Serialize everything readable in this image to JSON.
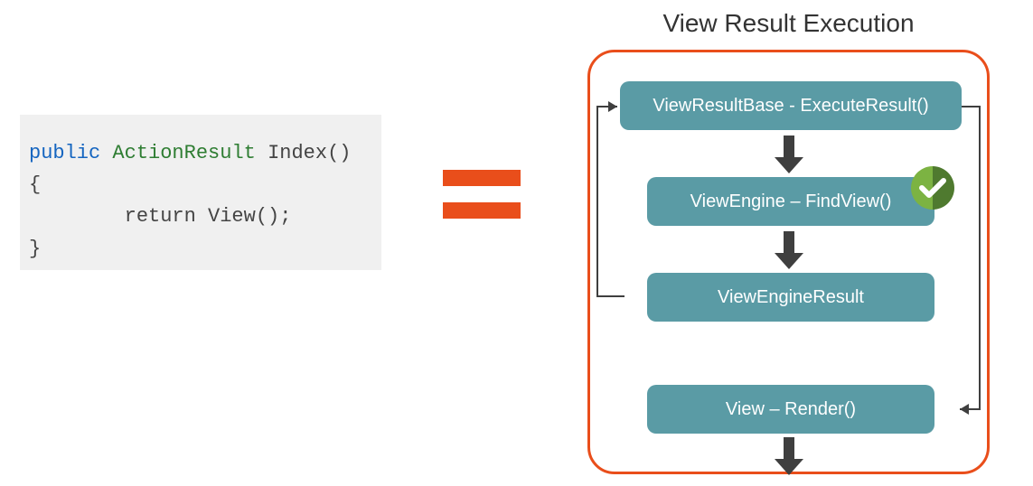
{
  "code": {
    "keyword_public": "public",
    "keyword_type": "ActionResult",
    "method_name": "Index()",
    "brace_open": "{",
    "return_line": "        return View();",
    "brace_close": "}"
  },
  "equals_symbol": "=",
  "diagram": {
    "title": "View Result Execution",
    "nodes": {
      "n1": "ViewResultBase  - ExecuteResult()",
      "n2": "ViewEngine – FindView()",
      "n3": "ViewEngineResult",
      "n4": "View – Render()"
    },
    "badge": "checkmark"
  },
  "colors": {
    "accent_orange": "#E94E1B",
    "node_teal": "#5A9BA5",
    "code_bg": "#f0f0f0",
    "kw_public": "#1565C0",
    "kw_type": "#2E7D32",
    "arrow": "#3f3f3f",
    "badge_green_dark": "#4F7A2F",
    "badge_green_light": "#7CB342"
  }
}
